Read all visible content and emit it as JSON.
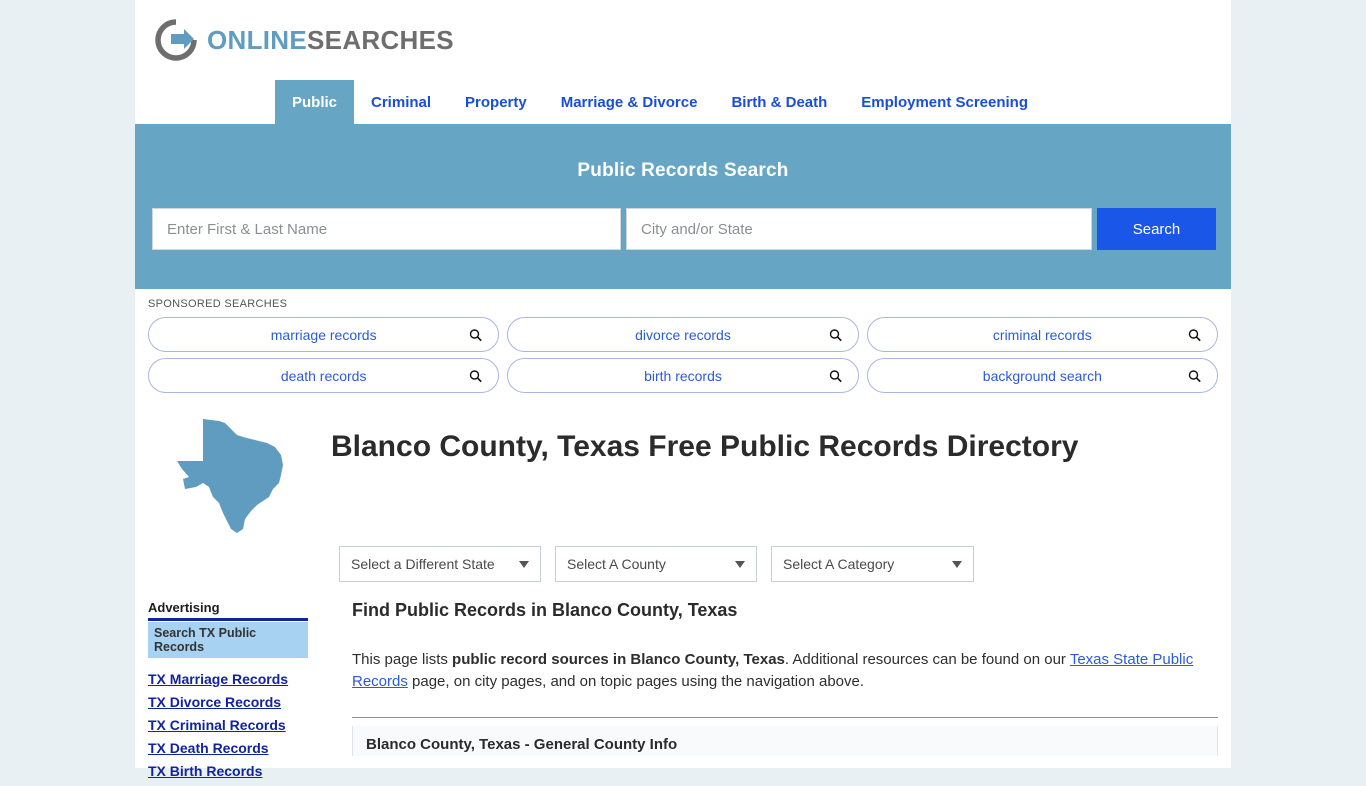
{
  "brand": {
    "name_part1": "ONLINE",
    "name_part2": "SEARCHES",
    "logo_icon": "circle-arrow-logo",
    "accent_teal": "#66a6c4",
    "accent_gray": "#6e6e6e"
  },
  "nav": {
    "items": [
      {
        "label": "Public",
        "active": true
      },
      {
        "label": "Criminal",
        "active": false
      },
      {
        "label": "Property",
        "active": false
      },
      {
        "label": "Marriage & Divorce",
        "active": false
      },
      {
        "label": "Birth & Death",
        "active": false
      },
      {
        "label": "Employment Screening",
        "active": false
      }
    ]
  },
  "hero": {
    "title": "Public Records Search",
    "name_value": "",
    "name_placeholder": "Enter First & Last Name",
    "city_value": "",
    "city_placeholder": "City and/or State",
    "search_label": "Search",
    "search_button_color": "#1a56e8",
    "background_color": "#66a6c4"
  },
  "sponsored": {
    "label": "SPONSORED SEARCHES",
    "rows": [
      [
        {
          "label": "marriage records"
        },
        {
          "label": "divorce records"
        },
        {
          "label": "criminal records"
        }
      ],
      [
        {
          "label": "death records"
        },
        {
          "label": "birth records"
        },
        {
          "label": "background search"
        }
      ]
    ]
  },
  "title_block": {
    "state_icon": "texas-state-outline",
    "heading": "Blanco County, Texas Free Public Records Directory"
  },
  "selects": {
    "state": {
      "value": "Select a Different State"
    },
    "county": {
      "value": "Select A County"
    },
    "category": {
      "value": "Select A Category"
    }
  },
  "sidebar": {
    "ad_heading": "Advertising",
    "ad_box_label": "Search TX Public Records",
    "links": [
      {
        "label": "TX Marriage Records"
      },
      {
        "label": "TX Divorce Records"
      },
      {
        "label": "TX Criminal Records"
      },
      {
        "label": "TX Death Records"
      },
      {
        "label": "TX Birth Records"
      }
    ]
  },
  "content": {
    "section_heading": "Find Public Records in Blanco County, Texas",
    "para_lead": "This page lists ",
    "para_bold": "public record sources in Blanco County, Texas",
    "para_mid": ". Additional resources can be found on our ",
    "para_link": "Texas State Public Records",
    "para_tail": " page, on city pages, and on topic pages using the navigation above.",
    "info_panel_title": "Blanco County, Texas - General County Info"
  }
}
